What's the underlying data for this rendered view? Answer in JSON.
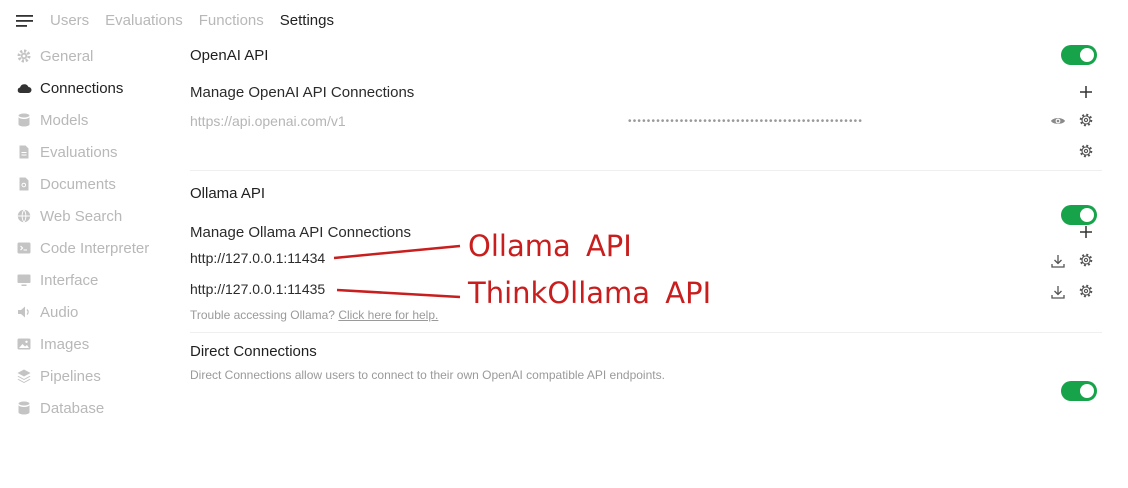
{
  "topbar": {
    "tabs": [
      {
        "label": "Users",
        "active": false
      },
      {
        "label": "Evaluations",
        "active": false
      },
      {
        "label": "Functions",
        "active": false
      },
      {
        "label": "Settings",
        "active": true
      }
    ]
  },
  "sidebar": {
    "items": [
      {
        "label": "General",
        "icon": "gear-icon",
        "active": false
      },
      {
        "label": "Connections",
        "icon": "cloud-icon",
        "active": true
      },
      {
        "label": "Models",
        "icon": "database-icon",
        "active": false
      },
      {
        "label": "Evaluations",
        "icon": "document-icon",
        "active": false
      },
      {
        "label": "Documents",
        "icon": "document-search-icon",
        "active": false
      },
      {
        "label": "Web Search",
        "icon": "globe-icon",
        "active": false
      },
      {
        "label": "Code Interpreter",
        "icon": "terminal-icon",
        "active": false
      },
      {
        "label": "Interface",
        "icon": "monitor-icon",
        "active": false
      },
      {
        "label": "Audio",
        "icon": "speaker-icon",
        "active": false
      },
      {
        "label": "Images",
        "icon": "image-icon",
        "active": false
      },
      {
        "label": "Pipelines",
        "icon": "layers-icon",
        "active": false
      },
      {
        "label": "Database",
        "icon": "database-icon",
        "active": false
      }
    ]
  },
  "openai": {
    "title": "OpenAI API",
    "enabled": true,
    "manage_label": "Manage OpenAI API Connections",
    "url_placeholder": "https://api.openai.com/v1",
    "key_mask": "••••••••••••••••••••••••••••••••••••••••••••••••••"
  },
  "ollama": {
    "title": "Ollama API",
    "enabled": true,
    "manage_label": "Manage Ollama API Connections",
    "connections": [
      {
        "url": "http://127.0.0.1:11434"
      },
      {
        "url": "http://127.0.0.1:11435"
      }
    ],
    "help_text": "Trouble accessing Ollama?",
    "help_link": "Click here for help."
  },
  "direct": {
    "title": "Direct Connections",
    "enabled": true,
    "description": "Direct Connections allow users to connect to their own OpenAI compatible API endpoints."
  },
  "annotations": {
    "label_1": "Ollama  API",
    "label_2": "ThinkOllama  API",
    "color": "#c81e1e"
  },
  "colors": {
    "toggle_on": "#16a34a"
  }
}
